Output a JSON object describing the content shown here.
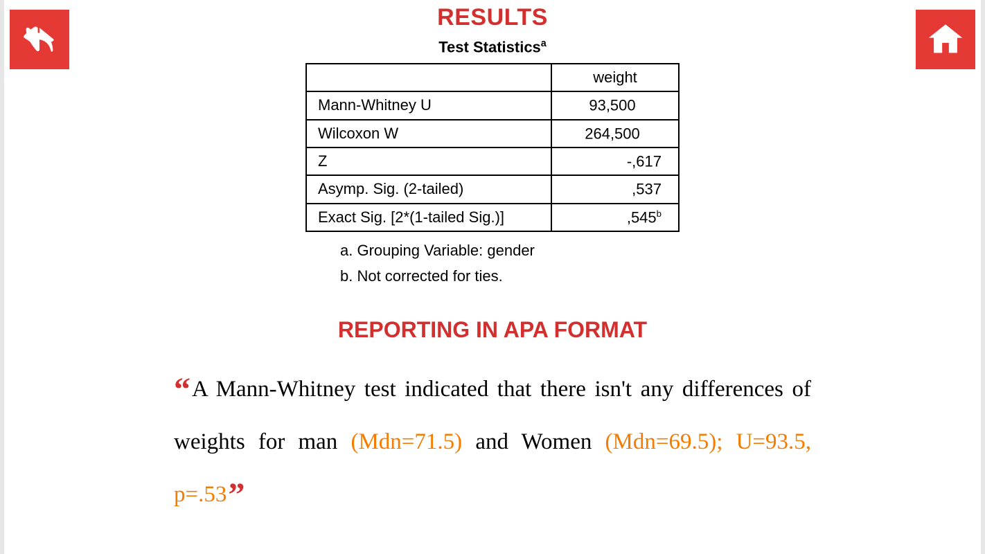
{
  "header": {
    "results_title": "RESULTS",
    "table_caption": "Test Statistics",
    "table_caption_sup": "a",
    "col_header": "weight"
  },
  "table": {
    "rows": [
      {
        "label": "Mann-Whitney U",
        "value": "93,500",
        "sup": ""
      },
      {
        "label": "Wilcoxon W",
        "value": "264,500",
        "sup": ""
      },
      {
        "label": "Z",
        "value": "-,617",
        "sup": ""
      },
      {
        "label": "Asymp. Sig. (2-tailed)",
        "value": ",537",
        "sup": ""
      },
      {
        "label": "Exact Sig. [2*(1-tailed Sig.)]",
        "value": ",545",
        "sup": "b"
      }
    ]
  },
  "footnotes": {
    "a": "a. Grouping Variable: gender",
    "b": "b. Not corrected for ties."
  },
  "apa": {
    "title": "REPORTING IN APA FORMAT",
    "text_part1": "A Mann-Whitney test indicated that there isn't any differences of weights for man ",
    "mdn1": "(Mdn=71.5)",
    "text_part2": " and Women ",
    "mdn2": "(Mdn=69.5); U=93.5, p=.53"
  },
  "icons": {
    "back": "back-icon",
    "home": "home-icon",
    "quote_open": "“",
    "quote_close": "”"
  },
  "colors": {
    "accent": "#d32f2f",
    "button": "#e53935",
    "orange": "#f57c00"
  }
}
